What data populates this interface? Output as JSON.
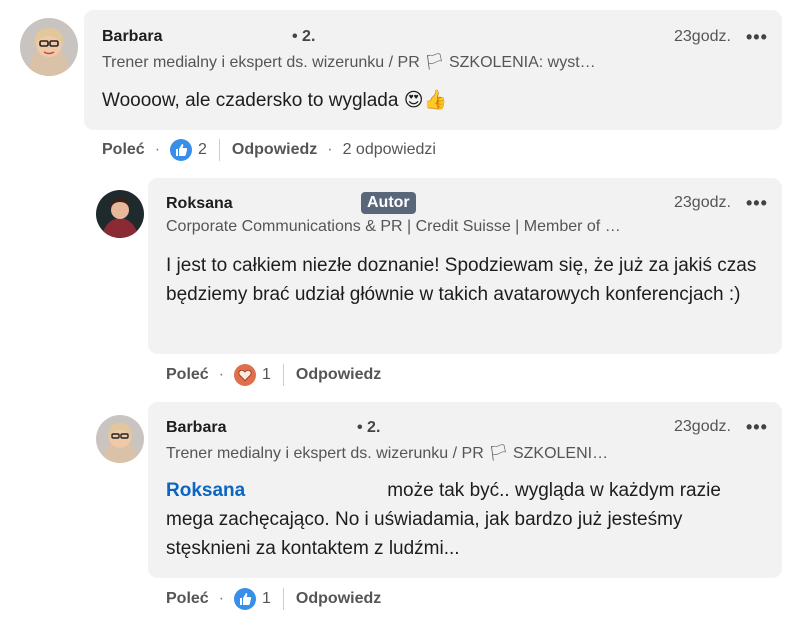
{
  "comments": [
    {
      "author": "Barbara",
      "degree": "• 2.",
      "time": "23godz.",
      "more": "•••",
      "headline": "Trener medialny i ekspert ds. wizerunku / PR 🏳 SZKOLENIA: wyst…",
      "text": "Woooow, ale czadersko to wyglada 😍👍",
      "like_label": "Poleć",
      "reaction_type": "like",
      "reaction_count": "2",
      "reply_label": "Odpowiedz",
      "replies_label": "2 odpowiedzi"
    },
    {
      "author": "Roksana",
      "badge": "Autor",
      "time": "23godz.",
      "more": "•••",
      "headline": "Corporate Communications & PR | Credit Suisse | Member of …",
      "text": "I jest to całkiem niezłe doznanie! Spodziewam się, że już za jakiś czas będziemy brać udział głównie w takich avatarowych konferencjach :)",
      "like_label": "Poleć",
      "reaction_type": "love",
      "reaction_count": "1",
      "reply_label": "Odpowiedz"
    },
    {
      "author": "Barbara",
      "degree": "• 2.",
      "time": "23godz.",
      "more": "•••",
      "headline": "Trener medialny i ekspert ds. wizerunku / PR 🏳 SZKOLENI…",
      "mention": "Roksana",
      "text": "może tak być.. wygląda w każdym razie mega zachęcająco. No i uświadamia, jak bardzo już jesteśmy stęsknieni za kontaktem z ludźmi...",
      "like_label": "Poleć",
      "reaction_type": "like",
      "reaction_count": "1",
      "reply_label": "Odpowiedz"
    }
  ],
  "separators": {
    "dot": "·"
  },
  "colors": {
    "like": "#378fe9",
    "love": "#df704d",
    "mention": "#0a66c2",
    "badge": "#58677a"
  },
  "icons": {
    "headline_icon": "video-camera-icon",
    "like_icon": "thumbs-up-icon",
    "love_icon": "heart-icon"
  }
}
